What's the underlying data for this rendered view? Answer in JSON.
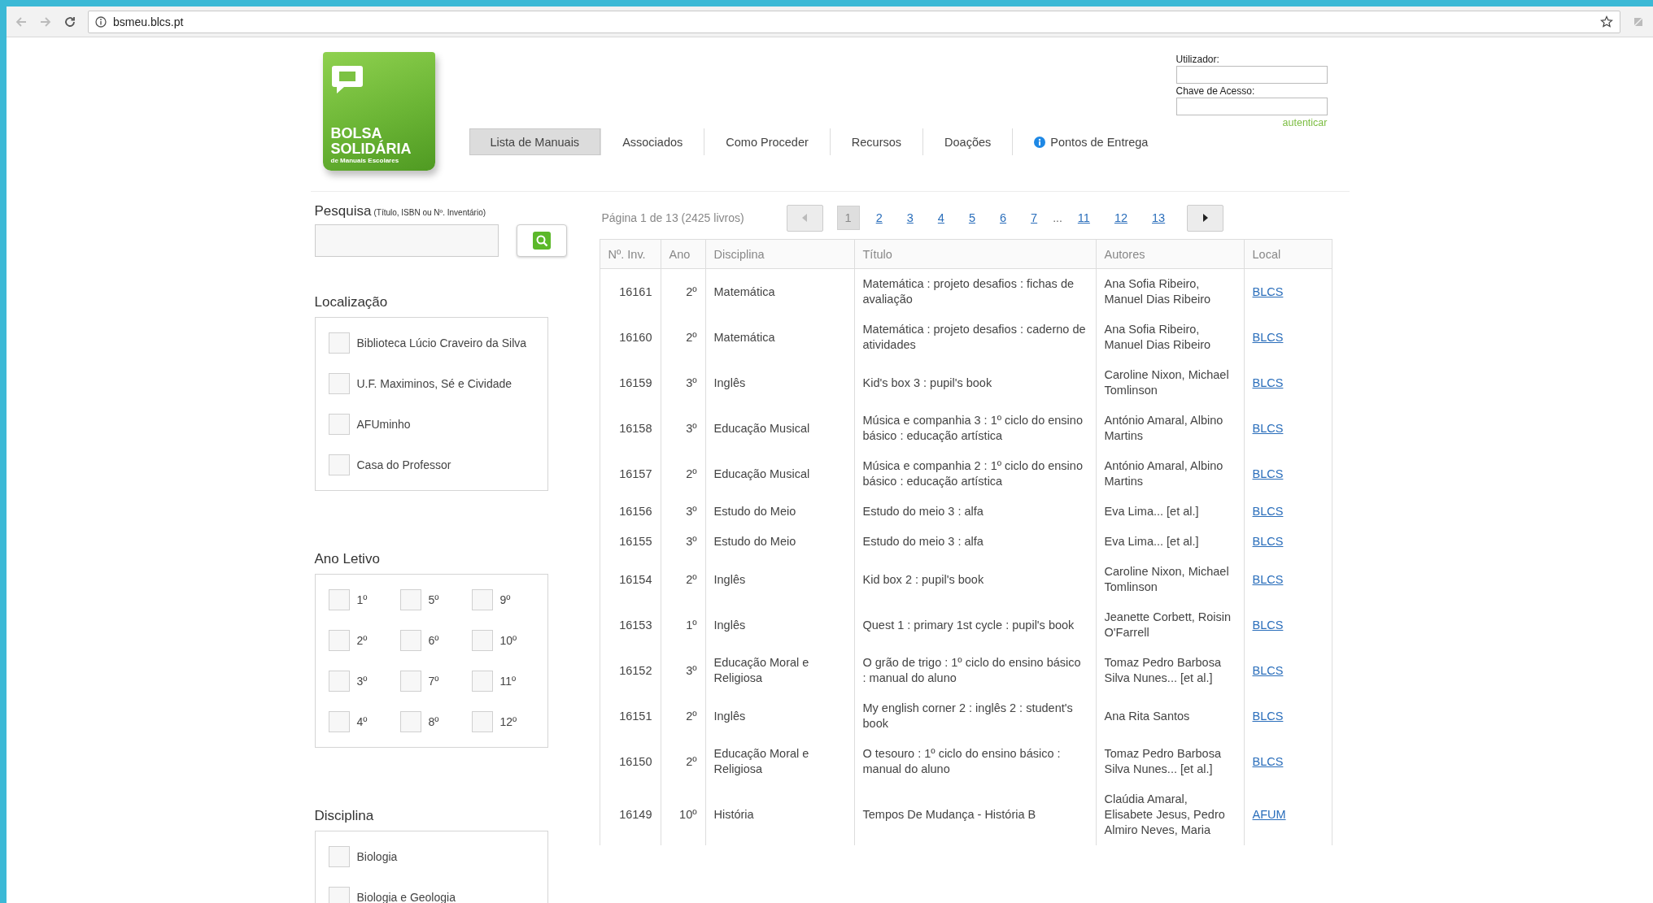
{
  "browser": {
    "url": "bsmeu.blcs.pt"
  },
  "header": {
    "logo": {
      "brand": "BOLSA SOLIDÁRIA",
      "tagline": "de Manuais Escolares"
    },
    "nav": [
      {
        "label": "Lista de Manuais",
        "selected": true,
        "kind": "plain"
      },
      {
        "label": "Associados",
        "selected": false,
        "kind": "plain"
      },
      {
        "label": "Como Proceder",
        "selected": false,
        "kind": "plain"
      },
      {
        "label": "Recursos",
        "selected": false,
        "kind": "plain"
      },
      {
        "label": "Doações",
        "selected": false,
        "kind": "plain"
      },
      {
        "label": "Pontos de Entrega",
        "selected": false,
        "kind": "info"
      }
    ],
    "login": {
      "user_label": "Utilizador:",
      "password_label": "Chave de Acesso:",
      "submit": "autenticar"
    }
  },
  "search": {
    "label": "Pesquisa",
    "hint": "(Título, ISBN ou Nº. Inventário)"
  },
  "filters": [
    {
      "title": "Localização",
      "kind": "list",
      "options": [
        {
          "label": "Biblioteca Lúcio Craveiro da Silva",
          "checked": false
        },
        {
          "label": "U.F. Maximinos, Sé e Cividade",
          "checked": false
        },
        {
          "label": "AFUminho",
          "checked": false
        },
        {
          "label": "Casa do Professor",
          "checked": false
        }
      ]
    },
    {
      "title": "Ano Letivo",
      "kind": "grid",
      "options": [
        {
          "label": "1º",
          "checked": false
        },
        {
          "label": "5º",
          "checked": false
        },
        {
          "label": "9º",
          "checked": false
        },
        {
          "label": "2º",
          "checked": false
        },
        {
          "label": "6º",
          "checked": false
        },
        {
          "label": "10º",
          "checked": false
        },
        {
          "label": "3º",
          "checked": false
        },
        {
          "label": "7º",
          "checked": false
        },
        {
          "label": "11º",
          "checked": false
        },
        {
          "label": "4º",
          "checked": false
        },
        {
          "label": "8º",
          "checked": false
        },
        {
          "label": "12º",
          "checked": false
        }
      ]
    },
    {
      "title": "Disciplina",
      "kind": "list",
      "options": [
        {
          "label": "Biologia",
          "checked": false
        },
        {
          "label": "Biologia e Geologia",
          "checked": false
        }
      ]
    }
  ],
  "pagination": {
    "summary": "Página 1 de 13 (2425 livros)",
    "prev": {
      "disabled": true
    },
    "next": {
      "disabled": false
    },
    "pages": [
      {
        "label": "1",
        "selected": true,
        "kind": "page"
      },
      {
        "label": "2",
        "selected": false,
        "kind": "page"
      },
      {
        "label": "3",
        "selected": false,
        "kind": "page"
      },
      {
        "label": "4",
        "selected": false,
        "kind": "page"
      },
      {
        "label": "5",
        "selected": false,
        "kind": "page"
      },
      {
        "label": "6",
        "selected": false,
        "kind": "page"
      },
      {
        "label": "7",
        "selected": false,
        "kind": "page"
      },
      {
        "label": "...",
        "kind": "ellipsis"
      },
      {
        "label": "11",
        "selected": false,
        "kind": "page"
      },
      {
        "label": "12",
        "selected": false,
        "kind": "page"
      },
      {
        "label": "13",
        "selected": false,
        "kind": "page"
      }
    ]
  },
  "table": {
    "columns": [
      "Nº. Inv.",
      "Ano",
      "Disciplina",
      "Título",
      "Autores",
      "Local"
    ],
    "rows": [
      {
        "inv": "16161",
        "ano": "2º",
        "disciplina": "Matemática",
        "titulo": "Matemática : projeto desafios : fichas de avaliação",
        "autores": "Ana Sofia Ribeiro, Manuel Dias Ribeiro",
        "local": "BLCS"
      },
      {
        "inv": "16160",
        "ano": "2º",
        "disciplina": "Matemática",
        "titulo": "Matemática : projeto desafios : caderno de atividades",
        "autores": "Ana Sofia Ribeiro, Manuel Dias Ribeiro",
        "local": "BLCS"
      },
      {
        "inv": "16159",
        "ano": "3º",
        "disciplina": "Inglês",
        "titulo": "Kid's box 3 : pupil's book",
        "autores": "Caroline Nixon, Michael Tomlinson",
        "local": "BLCS"
      },
      {
        "inv": "16158",
        "ano": "3º",
        "disciplina": "Educação Musical",
        "titulo": "Música e companhia 3 : 1º ciclo do ensino básico : educação artística",
        "autores": "António Amaral, Albino Martins",
        "local": "BLCS"
      },
      {
        "inv": "16157",
        "ano": "2º",
        "disciplina": "Educação Musical",
        "titulo": "Música e companhia 2 : 1º ciclo do ensino básico : educação artística",
        "autores": "António Amaral, Albino Martins",
        "local": "BLCS"
      },
      {
        "inv": "16156",
        "ano": "3º",
        "disciplina": "Estudo do Meio",
        "titulo": "Estudo do meio 3 : alfa",
        "autores": "Eva Lima... [et al.]",
        "local": "BLCS"
      },
      {
        "inv": "16155",
        "ano": "3º",
        "disciplina": "Estudo do Meio",
        "titulo": "Estudo do meio 3 : alfa",
        "autores": "Eva Lima... [et al.]",
        "local": "BLCS"
      },
      {
        "inv": "16154",
        "ano": "2º",
        "disciplina": "Inglês",
        "titulo": "Kid box 2 : pupil's book",
        "autores": "Caroline Nixon, Michael Tomlinson",
        "local": "BLCS"
      },
      {
        "inv": "16153",
        "ano": "1º",
        "disciplina": "Inglês",
        "titulo": "Quest 1 : primary 1st cycle : pupil's book",
        "autores": "Jeanette Corbett, Roisin O'Farrell",
        "local": "BLCS"
      },
      {
        "inv": "16152",
        "ano": "3º",
        "disciplina": "Educação Moral e Religiosa",
        "titulo": "O grão de trigo : 1º ciclo do ensino básico : manual do aluno",
        "autores": "Tomaz Pedro Barbosa Silva Nunes... [et al.]",
        "local": "BLCS"
      },
      {
        "inv": "16151",
        "ano": "2º",
        "disciplina": "Inglês",
        "titulo": "My english corner 2 : inglês 2 : student's book",
        "autores": "Ana Rita Santos",
        "local": "BLCS"
      },
      {
        "inv": "16150",
        "ano": "2º",
        "disciplina": "Educação Moral e Religiosa",
        "titulo": "O tesouro : 1º ciclo do ensino básico : manual do aluno",
        "autores": "Tomaz Pedro Barbosa Silva Nunes... [et al.]",
        "local": "BLCS"
      },
      {
        "inv": "16149",
        "ano": "10º",
        "disciplina": "História",
        "titulo": "Tempos De Mudança - História B",
        "autores": "Claúdia Amaral, Elisabete Jesus, Pedro Almiro Neves, Maria",
        "local": "AFUM"
      }
    ]
  }
}
